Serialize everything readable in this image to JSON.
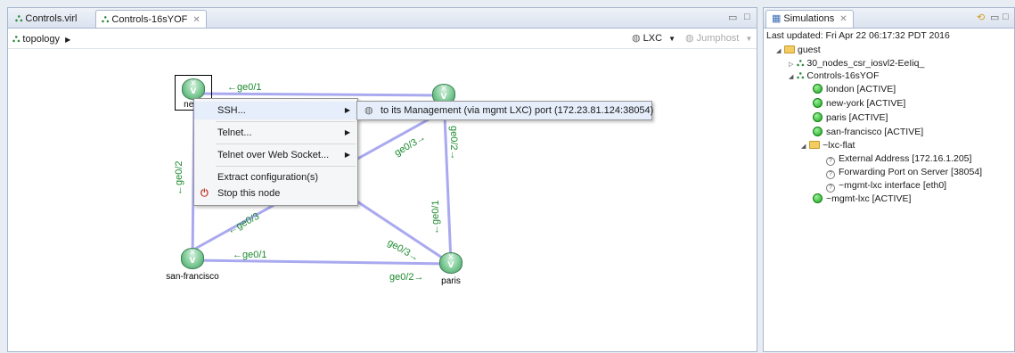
{
  "editor": {
    "tabs": [
      {
        "label": "Controls.virl",
        "active": false
      },
      {
        "label": "Controls-16sYOF",
        "active": true
      }
    ],
    "close_glyph": "✕",
    "breadcrumb": "topology",
    "toolbar": {
      "lxc_label": "LXC",
      "jumphost_label": "Jumphost"
    }
  },
  "topology": {
    "nodes": [
      {
        "id": "new-york",
        "label": "new-"
      },
      {
        "id": "london",
        "label": ""
      },
      {
        "id": "san-francisco",
        "label": "san-francisco"
      },
      {
        "id": "paris",
        "label": "paris"
      }
    ],
    "interfaces": {
      "ny_ge01": "←ge0/1",
      "ny_ge02": "←ge0/2",
      "ny_ge03": "←ge0/3",
      "london_ge03": "ge0/3→",
      "london_ge02": "ge0/2→",
      "paris_ge01": "←ge0/1",
      "paris_ge03": "ge0/3→",
      "paris_ge02": "ge0/2→",
      "sf_ge01": "←ge0/1"
    }
  },
  "context_menu": {
    "items": [
      {
        "label": "SSH...",
        "submenu": true
      },
      {
        "label": "Telnet...",
        "submenu": true
      },
      {
        "label": "Telnet over Web Socket...",
        "submenu": true
      },
      {
        "label": "Extract configuration(s)",
        "submenu": false
      },
      {
        "label": "Stop this node",
        "submenu": false
      }
    ],
    "submenu_item": "to its Management (via mgmt LXC) port (172.23.81.124:38054)"
  },
  "simulations": {
    "tab_label": "Simulations",
    "last_updated": "Last updated: Fri Apr 22 06:17:32 PDT 2016",
    "tree": {
      "guest": "guest",
      "sim1": "30_nodes_csr_iosvl2-EeIiq_",
      "sim2": "Controls-16sYOF",
      "nodes": [
        "london [ACTIVE]",
        "new-york  [ACTIVE]",
        "paris  [ACTIVE]",
        "san-francisco  [ACTIVE]"
      ],
      "lxc_flat": "~lxc-flat",
      "lxc_children": [
        "External Address  [172.16.1.205]",
        "Forwarding Port on Server  [38054]",
        "~mgmt-lxc interface  [eth0]"
      ],
      "mgmt_lxc": "~mgmt-lxc  [ACTIVE]"
    }
  },
  "colors": {
    "link": "#a9a9f0",
    "iface_text": "#1c8a2e",
    "panel_border": "#a9b8cf"
  }
}
